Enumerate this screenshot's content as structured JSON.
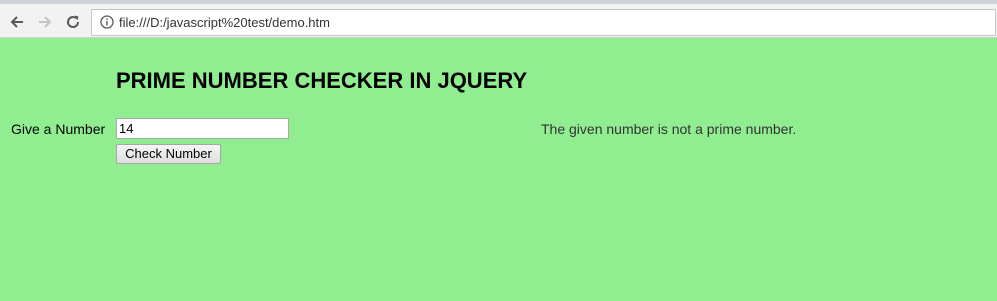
{
  "browser": {
    "url": "file:///D:/javascript%20test/demo.htm",
    "icons": {
      "back": "arrow-left-icon",
      "forward": "arrow-right-icon",
      "reload": "reload-icon",
      "info": "info-icon"
    }
  },
  "page": {
    "background_color": "#90ee90",
    "title": "PRIME NUMBER CHECKER IN JQUERY",
    "number_label": "Give a Number",
    "number_value": "14",
    "check_button_label": "Check Number",
    "result_text": "The given number is not a prime number."
  }
}
